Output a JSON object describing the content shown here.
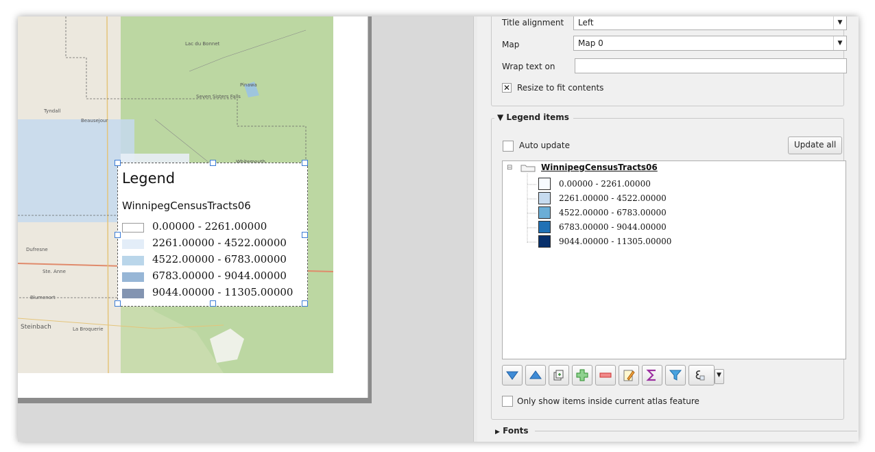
{
  "map": {
    "places": [
      "Lac du Bonnet",
      "Pinawa",
      "Seven Sisters Falls",
      "Tyndall",
      "Beausejour",
      "Whitemouth",
      "Dufresne",
      "Ste. Anne",
      "Blumenort",
      "Steinbach",
      "La Broquerie"
    ]
  },
  "legend": {
    "title": "Legend",
    "layer": "WinnipegCensusTracts06",
    "items": [
      {
        "label": "0.00000 - 2261.00000",
        "color": "#ffffff"
      },
      {
        "label": "2261.00000 - 4522.00000",
        "color": "#e3edf8"
      },
      {
        "label": "4522.00000 - 6783.00000",
        "color": "#bad6ea"
      },
      {
        "label": "6783.00000 - 9044.00000",
        "color": "#97b6d6"
      },
      {
        "label": "9044.00000 - 11305.00000",
        "color": "#8394b1"
      }
    ]
  },
  "panel": {
    "title_alignment_label": "Title alignment",
    "title_alignment_value": "Left",
    "map_label": "Map",
    "map_value": "Map 0",
    "wrap_label": "Wrap text on",
    "wrap_value": "",
    "resize_label": "Resize to fit contents",
    "resize_checked": true,
    "legend_items_title": "Legend items",
    "auto_update_label": "Auto update",
    "update_all_label": "Update all",
    "tree_layer": "WinnipegCensusTracts06",
    "tree_items": [
      {
        "label": "0.00000 - 2261.00000",
        "color": "#f7fbff"
      },
      {
        "label": "2261.00000 - 4522.00000",
        "color": "#c6dbef"
      },
      {
        "label": "4522.00000 - 6783.00000",
        "color": "#6baed6"
      },
      {
        "label": "6783.00000 - 9044.00000",
        "color": "#2171b5"
      },
      {
        "label": "9044.00000 - 11305.00000",
        "color": "#08306b"
      }
    ],
    "toolbar_icons": [
      "move-down-icon",
      "move-up-icon",
      "add-group-icon",
      "add-item-icon",
      "remove-item-icon",
      "edit-item-icon",
      "sum-icon",
      "filter-icon",
      "expression-icon"
    ],
    "atlas_label": "Only show items inside current atlas feature",
    "fonts_title": "Fonts"
  }
}
